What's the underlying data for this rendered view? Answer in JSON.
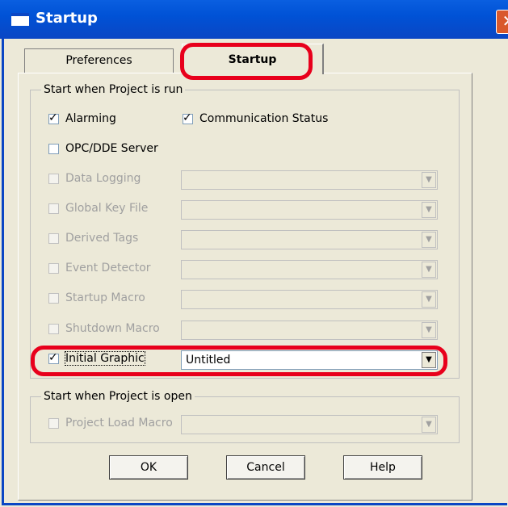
{
  "window": {
    "title": "Startup",
    "close_glyph": "✕"
  },
  "tabs": [
    {
      "label": "Preferences",
      "accel": "P"
    },
    {
      "label": "Startup"
    }
  ],
  "groups": {
    "run": {
      "label": "Start when Project is run"
    },
    "open": {
      "label": "Start when Project is open"
    }
  },
  "items": {
    "alarming": {
      "label": "Alarming",
      "checked": true
    },
    "comm_status": {
      "label": "Communication Status",
      "checked": true
    },
    "opc_dde": {
      "label": "OPC/DDE Server",
      "checked": false
    },
    "data_logging": {
      "label": "Data Logging",
      "checked": false
    },
    "global_key": {
      "label": "Global Key File",
      "checked": false
    },
    "derived_tags": {
      "label": "Derived Tags",
      "checked": false
    },
    "event_detector": {
      "label": "Event Detector",
      "checked": false
    },
    "startup_macro": {
      "label": "Startup Macro",
      "checked": false
    },
    "shutdown_macro": {
      "label": "Shutdown Macro",
      "checked": false
    },
    "initial_graphic": {
      "label": "Initial Graphic",
      "checked": true,
      "value": "Untitled"
    },
    "project_load_macro": {
      "label": "Project Load Macro",
      "checked": false
    }
  },
  "buttons": {
    "ok": "OK",
    "cancel": "Cancel",
    "help": "Help"
  },
  "highlight_color": "#e8001c"
}
